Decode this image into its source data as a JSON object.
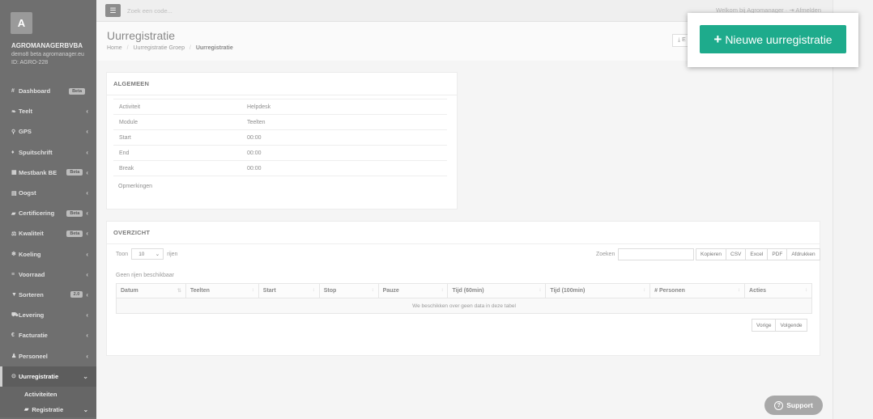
{
  "sidebar": {
    "logo_letter": "A",
    "company": "AGROMANAGERBVBA",
    "company_line1": "demo8 beta agromanager.eu",
    "company_line2": "ID: AGRO-228",
    "items": [
      {
        "icon": "#",
        "label": "Dashboard",
        "badge": "Beta",
        "chevron": ""
      },
      {
        "icon": "❧",
        "label": "Teelt",
        "badge": "",
        "chevron": "‹"
      },
      {
        "icon": "⚲",
        "label": "GPS",
        "badge": "",
        "chevron": "‹"
      },
      {
        "icon": "♦",
        "label": "Spuitschrift",
        "badge": "",
        "chevron": "‹"
      },
      {
        "icon": "▦",
        "label": "Mestbank BE",
        "badge": "Beta",
        "chevron": "‹"
      },
      {
        "icon": "▤",
        "label": "Oogst",
        "badge": "",
        "chevron": "‹"
      },
      {
        "icon": "▰",
        "label": "Certificering",
        "badge": "Beta",
        "chevron": "‹"
      },
      {
        "icon": "⚖",
        "label": "Kwaliteit",
        "badge": "Beta",
        "chevron": "‹"
      },
      {
        "icon": "❄",
        "label": "Koeling",
        "badge": "",
        "chevron": "‹"
      },
      {
        "icon": "≡",
        "label": "Voorraad",
        "badge": "",
        "chevron": "‹"
      },
      {
        "icon": "▼",
        "label": "Sorteren",
        "badge": "2.0",
        "chevron": "‹"
      },
      {
        "icon": "⛟",
        "label": "Levering",
        "badge": "",
        "chevron": "‹"
      },
      {
        "icon": "€",
        "label": "Facturatie",
        "badge": "",
        "chevron": "‹"
      },
      {
        "icon": "♟",
        "label": "Personeel",
        "badge": "",
        "chevron": "‹"
      },
      {
        "icon": "⊙",
        "label": "Uurregistratie",
        "badge": "",
        "chevron": "⌄"
      }
    ],
    "sub_items": [
      {
        "label": "Activiteiten",
        "chevron": ""
      },
      {
        "label": "Registratie",
        "chevron": "⌄"
      }
    ]
  },
  "topbar": {
    "search_placeholder": "Zoek een code...",
    "welcome": "Welkom bij Agromanager",
    "logout": "Afmelden"
  },
  "header": {
    "title": "Uurregistratie",
    "breadcrumb": [
      "Home",
      "Uurregistratie Groep",
      "Uurregistratie"
    ],
    "export_label": "E"
  },
  "algemeen": {
    "title": "ALGEMEEN",
    "rows": [
      {
        "key": "Activiteit",
        "value": "Helpdesk"
      },
      {
        "key": "Module",
        "value": "Teelten"
      },
      {
        "key": "Start",
        "value": "00:00"
      },
      {
        "key": "End",
        "value": "00:00"
      },
      {
        "key": "Break",
        "value": "00:00"
      }
    ],
    "note": "Opmerkingen"
  },
  "overzicht": {
    "title": "OVERZICHT",
    "show_prefix": "Toon",
    "page_size": "10",
    "show_suffix": "rijen",
    "search_label": "Zoeken",
    "export_buttons": [
      "Kopieren",
      "CSV",
      "Excel",
      "PDF",
      "Afdrukken"
    ],
    "info": "Geen rijen beschikbaar",
    "columns": [
      "Datum",
      "Teelten",
      "Start",
      "Stop",
      "Pauze",
      "Tijd (60min)",
      "Tijd (100min)",
      "# Personen",
      "Acties"
    ],
    "empty_message": "We beschikken over geen data in deze tabel",
    "prev": "Vorige",
    "next": "Volgende"
  },
  "popup": {
    "new_button": "Nieuwe uurregistratie"
  },
  "support": "Support",
  "colors": {
    "accent": "#1eab8c",
    "sidebar": "#6f6f6f"
  }
}
